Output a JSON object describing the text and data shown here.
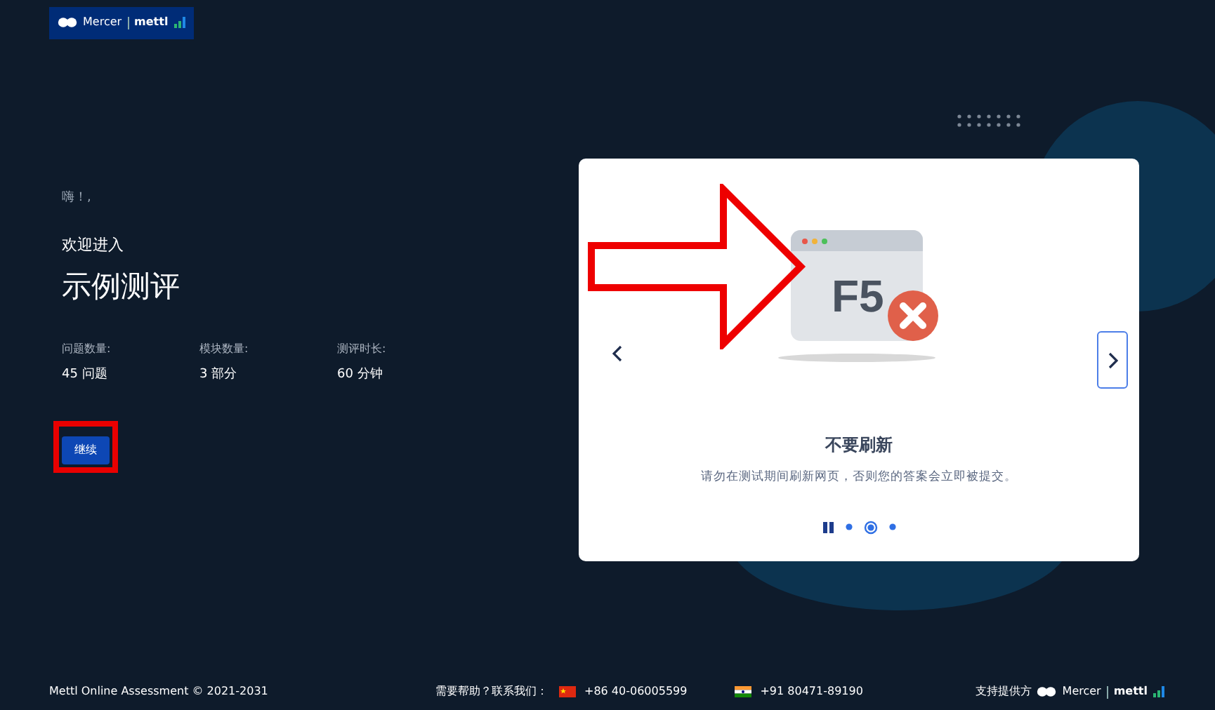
{
  "header": {
    "logo": {
      "brand": "Mercer",
      "product": "mettl"
    }
  },
  "intro": {
    "greeting": "嗨！,",
    "welcome": "欢迎进入",
    "title": "示例测评",
    "stats": [
      {
        "label": "问题数量:",
        "value": "45 问题"
      },
      {
        "label": "模块数量:",
        "value": "3 部分"
      },
      {
        "label": "测评时长:",
        "value": "60 分钟"
      }
    ],
    "button": "继续"
  },
  "carousel": {
    "illustration_key": "F5",
    "title": "不要刷新",
    "description": "请勿在测试期间刷新网页，否则您的答案会立即被提交。",
    "indicators": [
      {
        "selected": false
      },
      {
        "selected": true
      },
      {
        "selected": false
      }
    ]
  },
  "footer": {
    "copyright": "Mettl Online Assessment © 2021-2031",
    "help": "需要帮助？联系我们：",
    "phones": [
      {
        "kind": "china",
        "number": "+86 40-06005599"
      },
      {
        "kind": "india",
        "number": "+91 80471-89190"
      }
    ],
    "powered_by": "支持提供方",
    "logo": {
      "brand": "Mercer",
      "product": "mettl"
    }
  }
}
